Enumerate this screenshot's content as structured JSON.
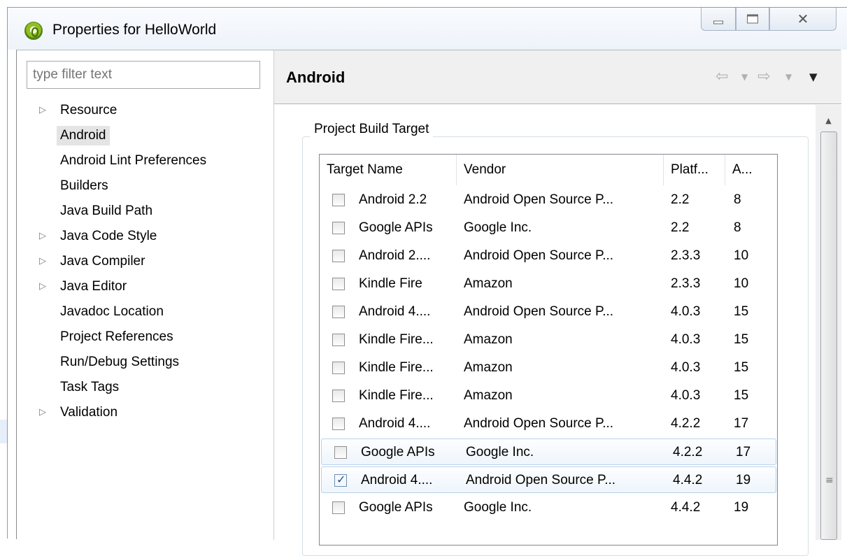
{
  "window": {
    "title": "Properties for HelloWorld",
    "close_glyph": "✕"
  },
  "filter": {
    "placeholder": "type filter text"
  },
  "tree": {
    "items": [
      {
        "label": "Resource",
        "expandable": true,
        "selected": false
      },
      {
        "label": "Android",
        "expandable": false,
        "selected": true
      },
      {
        "label": "Android Lint Preferences",
        "expandable": false,
        "selected": false
      },
      {
        "label": "Builders",
        "expandable": false,
        "selected": false
      },
      {
        "label": "Java Build Path",
        "expandable": false,
        "selected": false
      },
      {
        "label": "Java Code Style",
        "expandable": true,
        "selected": false
      },
      {
        "label": "Java Compiler",
        "expandable": true,
        "selected": false
      },
      {
        "label": "Java Editor",
        "expandable": true,
        "selected": false
      },
      {
        "label": "Javadoc Location",
        "expandable": false,
        "selected": false
      },
      {
        "label": "Project References",
        "expandable": false,
        "selected": false
      },
      {
        "label": "Run/Debug Settings",
        "expandable": false,
        "selected": false
      },
      {
        "label": "Task Tags",
        "expandable": false,
        "selected": false
      },
      {
        "label": "Validation",
        "expandable": true,
        "selected": false
      }
    ]
  },
  "page": {
    "title": "Android",
    "nav": {
      "back_glyph": "⇦",
      "forward_glyph": "⇨",
      "dropdown_glyph": "▼",
      "menu_glyph": "▼"
    }
  },
  "build_target": {
    "group_label": "Project Build Target",
    "columns": [
      "Target Name",
      "Vendor",
      "Platf...",
      "A..."
    ],
    "rows": [
      {
        "checked": false,
        "name": "Android 2.2",
        "vendor": "Android Open Source P...",
        "platform": "2.2",
        "api": "8",
        "highlighted": false
      },
      {
        "checked": false,
        "name": "Google APIs",
        "vendor": "Google Inc.",
        "platform": "2.2",
        "api": "8",
        "highlighted": false
      },
      {
        "checked": false,
        "name": "Android 2....",
        "vendor": "Android Open Source P...",
        "platform": "2.3.3",
        "api": "10",
        "highlighted": false
      },
      {
        "checked": false,
        "name": "Kindle Fire",
        "vendor": "Amazon",
        "platform": "2.3.3",
        "api": "10",
        "highlighted": false
      },
      {
        "checked": false,
        "name": "Android 4....",
        "vendor": "Android Open Source P...",
        "platform": "4.0.3",
        "api": "15",
        "highlighted": false
      },
      {
        "checked": false,
        "name": "Kindle Fire...",
        "vendor": "Amazon",
        "platform": "4.0.3",
        "api": "15",
        "highlighted": false
      },
      {
        "checked": false,
        "name": "Kindle Fire...",
        "vendor": "Amazon",
        "platform": "4.0.3",
        "api": "15",
        "highlighted": false
      },
      {
        "checked": false,
        "name": "Kindle Fire...",
        "vendor": "Amazon",
        "platform": "4.0.3",
        "api": "15",
        "highlighted": false
      },
      {
        "checked": false,
        "name": "Android 4....",
        "vendor": "Android Open Source P...",
        "platform": "4.2.2",
        "api": "17",
        "highlighted": false
      },
      {
        "checked": false,
        "name": "Google APIs",
        "vendor": "Google Inc.",
        "platform": "4.2.2",
        "api": "17",
        "highlighted": true
      },
      {
        "checked": true,
        "name": "Android 4....",
        "vendor": "Android Open Source P...",
        "platform": "4.4.2",
        "api": "19",
        "highlighted": true
      },
      {
        "checked": false,
        "name": "Google APIs",
        "vendor": "Google Inc.",
        "platform": "4.4.2",
        "api": "19",
        "highlighted": false
      }
    ]
  },
  "scrollbar": {
    "up_glyph": "▲",
    "grip_glyph": "≡"
  },
  "colors": {
    "selection_bg": "#e4e4e4",
    "row_highlight_border": "#b9d1ea",
    "header_bg": "#f0f0f0"
  }
}
